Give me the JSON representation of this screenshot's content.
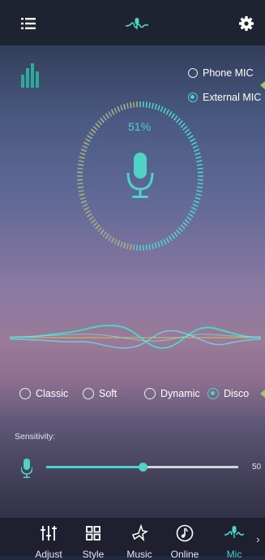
{
  "colors": {
    "accent": "#4fd3c6",
    "topbar": "#1d2331",
    "nav": "#1e2030",
    "gauge_alt": "#d8a84d"
  },
  "header": {
    "menu_icon": "hamburger-menu-icon",
    "logo_icon": "microphone-wave-logo-icon",
    "settings_icon": "gear-icon"
  },
  "mic_source": {
    "options": [
      {
        "label": "Phone MIC",
        "selected": false
      },
      {
        "label": "External MIC",
        "selected": true
      }
    ]
  },
  "gauge": {
    "percent_label": "51%",
    "level": 0.51
  },
  "styles": {
    "options": [
      {
        "label": "Classic",
        "selected": false
      },
      {
        "label": "Soft",
        "selected": false
      },
      {
        "label": "Dynamic",
        "selected": false
      },
      {
        "label": "Disco",
        "selected": true
      }
    ]
  },
  "sensitivity": {
    "label": "Sensitivity:",
    "value_text": "50",
    "level": 0.5
  },
  "nav": {
    "items": [
      {
        "label": "Adjust",
        "icon": "equalizer-sliders-icon",
        "active": false
      },
      {
        "label": "Style",
        "icon": "grid-icon",
        "active": false
      },
      {
        "label": "Music",
        "icon": "music-note-icon",
        "active": false
      },
      {
        "label": "Online",
        "icon": "online-music-icon",
        "active": false
      },
      {
        "label": "Mic",
        "icon": "microphone-wave-icon",
        "active": true
      }
    ],
    "more_glyph": "›"
  }
}
